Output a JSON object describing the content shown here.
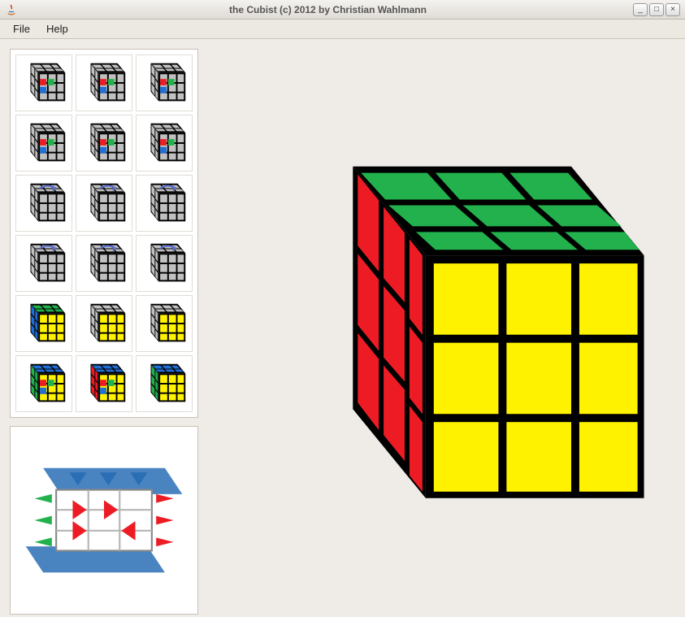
{
  "window": {
    "title": "the Cubist (c) 2012 by Christian Wahlmann",
    "minimize_label": "_",
    "maximize_label": "□",
    "close_label": "×"
  },
  "menu": {
    "file": "File",
    "help": "Help"
  },
  "colors": {
    "red": "#ed1c24",
    "green": "#22b14c",
    "yellow": "#fff200",
    "blue": "#1f6fd6",
    "orange": "#ff7f27",
    "white": "#ffffff",
    "grey": "#c0c0c0",
    "black": "#000000"
  },
  "cube": {
    "top_face": "green",
    "front_face": "yellow",
    "left_face": "red"
  },
  "thumbnails": [
    {
      "id": "step-1a",
      "top": "grey",
      "front": "grey",
      "left": "grey",
      "accent": "mixed"
    },
    {
      "id": "step-1b",
      "top": "grey",
      "front": "grey",
      "left": "grey",
      "accent": "mixed"
    },
    {
      "id": "step-1c",
      "top": "grey",
      "front": "grey",
      "left": "grey",
      "accent": "mixed"
    },
    {
      "id": "step-2a",
      "top": "grey",
      "front": "grey",
      "left": "grey",
      "accent": "mixed"
    },
    {
      "id": "step-2b",
      "top": "grey",
      "front": "grey",
      "left": "grey",
      "accent": "mixed"
    },
    {
      "id": "step-2c",
      "top": "grey",
      "front": "grey",
      "left": "grey",
      "accent": "mixed"
    },
    {
      "id": "step-3a",
      "top": "grey",
      "front": "grey",
      "left": "grey",
      "accent": "arrow"
    },
    {
      "id": "step-3b",
      "top": "grey",
      "front": "grey",
      "left": "grey",
      "accent": "arrow"
    },
    {
      "id": "step-3c",
      "top": "grey",
      "front": "grey",
      "left": "grey",
      "accent": "arrow"
    },
    {
      "id": "step-4a",
      "top": "grey",
      "front": "grey",
      "left": "grey",
      "accent": "arrow"
    },
    {
      "id": "step-4b",
      "top": "grey",
      "front": "grey",
      "left": "grey",
      "accent": "arrow"
    },
    {
      "id": "step-4c",
      "top": "grey",
      "front": "grey",
      "left": "grey",
      "accent": "arrow"
    },
    {
      "id": "step-5a",
      "top": "green",
      "front": "yellow",
      "left": "blue",
      "accent": "none"
    },
    {
      "id": "step-5b",
      "top": "grey",
      "front": "yellow",
      "left": "grey",
      "accent": "none"
    },
    {
      "id": "step-5c",
      "top": "grey",
      "front": "yellow",
      "left": "grey",
      "accent": "none"
    },
    {
      "id": "step-6a",
      "top": "blue",
      "front": "yellow",
      "left": "green",
      "accent": "mixed"
    },
    {
      "id": "step-6b",
      "top": "blue",
      "front": "yellow",
      "left": "red",
      "accent": "mixed"
    },
    {
      "id": "step-6c",
      "top": "blue",
      "front": "yellow",
      "left": "green",
      "accent": "none"
    }
  ]
}
